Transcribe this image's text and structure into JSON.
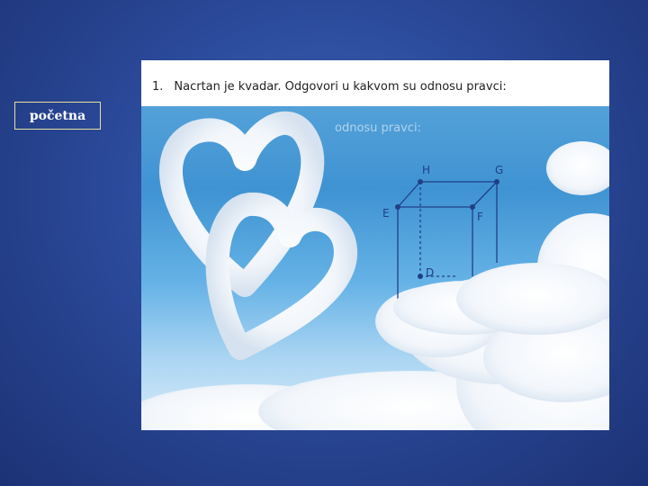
{
  "nav": {
    "home_label": "početna"
  },
  "task": {
    "number": "1.",
    "text": "Nacrtan je kvadar. Odgovori u kakvom su odnosu pravci:",
    "echo": "odnosu pravci:"
  },
  "cube": {
    "vertex_labels": {
      "H": "H",
      "G": "G",
      "E": "E",
      "F": "F",
      "D": "D"
    }
  },
  "colors": {
    "page_bg": "#2b4a9a",
    "button_border": "#e8e0a0",
    "sky": "#3f93d2"
  }
}
